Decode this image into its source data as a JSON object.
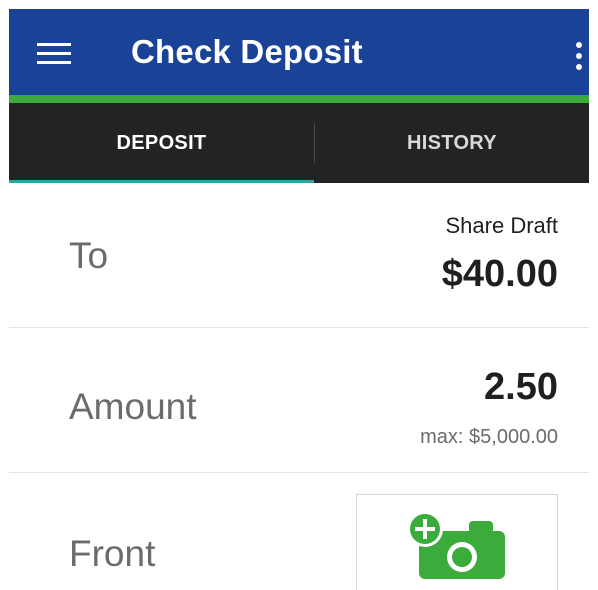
{
  "header": {
    "title": "Check Deposit",
    "bar_color": "#1a4296",
    "accent_color": "#3bab3c",
    "menu_icon": "hamburger-menu-icon",
    "overflow_icon": "more-vertical-icon"
  },
  "tabs": [
    {
      "label": "DEPOSIT",
      "selected": true
    },
    {
      "label": "HISTORY",
      "selected": false
    }
  ],
  "to": {
    "label": "To",
    "account_name": "Share Draft",
    "balance": "$40.00"
  },
  "amount": {
    "label": "Amount",
    "value": "2.50",
    "max_text": "max: $5,000.00"
  },
  "front": {
    "label": "Front",
    "capture_icon": "add-camera-icon",
    "icon_color": "#3bab3c"
  }
}
